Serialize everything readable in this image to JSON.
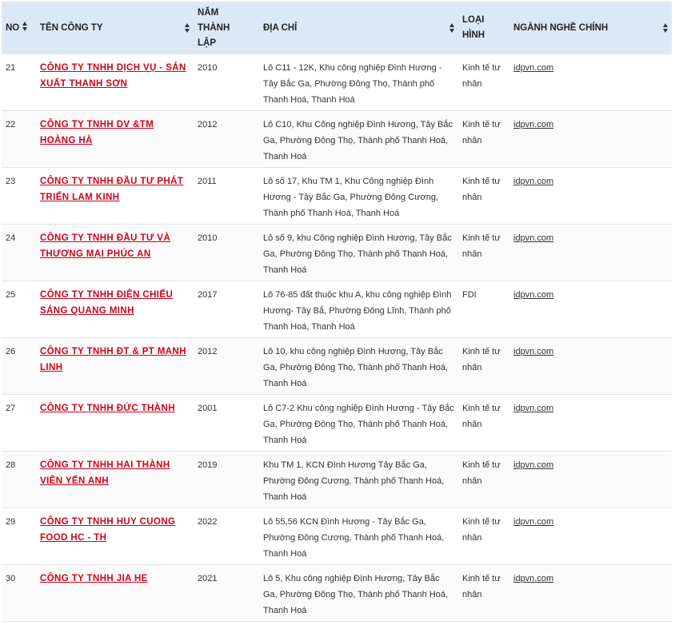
{
  "headers": {
    "no": "NO",
    "name": "TÊN CÔNG TY",
    "year": [
      "NĂM",
      "THÀNH",
      "LẬP"
    ],
    "address": "ĐỊA CHỈ",
    "type": [
      "LOẠI",
      "HÌNH"
    ],
    "industry": "NGÀNH NGHỀ CHÍNH"
  },
  "rows": [
    {
      "no": "21",
      "name": "CÔNG TY TNHH DỊCH VỤ - SẢN XUẤT THANH SƠN",
      "year": "2010",
      "address": "Lô C11 - 12K, Khu công nghiệp Đình Hương - Tây Bắc Ga, Phường Đông Thọ, Thành phố Thanh Hoá, Thanh Hoá",
      "type": "Kinh tế tư nhân",
      "site": "idpvn.com"
    },
    {
      "no": "22",
      "name": "CÔNG TY TNHH DV &TM HOÀNG HÀ",
      "year": "2012",
      "address": "Lô C10, Khu Công nghiệp Đình Hương, Tây Bắc Ga, Phường Đông Thọ, Thành phố Thanh Hoá, Thanh Hoá",
      "type": "Kinh tế tư nhân",
      "site": "idpvn.com"
    },
    {
      "no": "23",
      "name": "CÔNG TY TNHH ĐẦU TƯ PHÁT TRIỂN LAM KINH",
      "year": "2011",
      "address": "Lô số 17, Khu TM 1, Khu Công nghiệp Đình Hương - Tây Bắc Ga, Phường Đông Cương, Thành phố Thanh Hoá, Thanh Hoá",
      "type": "Kinh tế tư nhân",
      "site": "idpvn.com"
    },
    {
      "no": "24",
      "name": "CÔNG TY TNHH ĐẦU TƯ VÀ THƯƠNG MẠI PHÚC AN",
      "year": "2010",
      "address": "Lô số 9, khu Công nghiệp Đình Hương, Tây Bắc Ga, Phường Đông Thọ, Thành phố Thanh Hoá, Thanh Hoá",
      "type": "Kinh tế tư nhân",
      "site": "idpvn.com"
    },
    {
      "no": "25",
      "name": "CÔNG TY TNHH ĐIỆN CHIẾU SÁNG QUANG MINH",
      "year": "2017",
      "address": "Lô 76-85 đất thuộc khu A, khu công nghiệp Đình Hương- Tây Bắ, Phường Đông Lĩnh, Thành phố Thanh Hoá, Thanh Hoá",
      "type": "FDI",
      "site": "idpvn.com"
    },
    {
      "no": "26",
      "name": "CÔNG TY TNHH ĐT & PT MẠNH LINH",
      "year": "2012",
      "address": "Lô 10, khu công nghiệp Đình Hương, Tây Bắc Ga, Phường Đông Thọ, Thành phố Thanh Hoá, Thanh Hoá",
      "type": "Kinh tế tư nhân",
      "site": "idpvn.com"
    },
    {
      "no": "27",
      "name": "CÔNG TY TNHH ĐỨC THÀNH",
      "year": "2001",
      "address": "Lô C7-2 Khu công nghiệp Đình Hương - Tây Bắc Ga, Phường Đông Thọ, Thành phố Thanh Hoá, Thanh Hoá",
      "type": "Kinh tế tư nhân",
      "site": "idpvn.com"
    },
    {
      "no": "28",
      "name": "CÔNG TY TNHH HAI THÀNH VIÊN YẾN ANH",
      "year": "2019",
      "address": "Khu TM 1, KCN Đình Hương Tây Bắc Ga, Phường Đông Cương, Thành phố Thanh Hoá, Thanh Hoá",
      "type": "Kinh tế tư nhân",
      "site": "idpvn.com"
    },
    {
      "no": "29",
      "name": "CÔNG TY TNHH HUY CUONG FOOD HC - TH",
      "year": "2022",
      "address": "Lô 55,56 KCN Đình Hương - Tây Bắc Ga, Phường Đông Cương, Thành phố Thanh Hoá, Thanh Hoá",
      "type": "Kinh tế tư nhân",
      "site": "idpvn.com"
    },
    {
      "no": "30",
      "name": "CÔNG TY TNHH JIA HE",
      "year": "2021",
      "address": "Lô 5, Khu công nghiệp Đình Hương, Tây Bắc Ga, Phường Đông Thọ, Thành phố Thanh Hoá, Thanh Hoá",
      "type": "Kinh tế tư nhân",
      "site": "idpvn.com"
    }
  ]
}
